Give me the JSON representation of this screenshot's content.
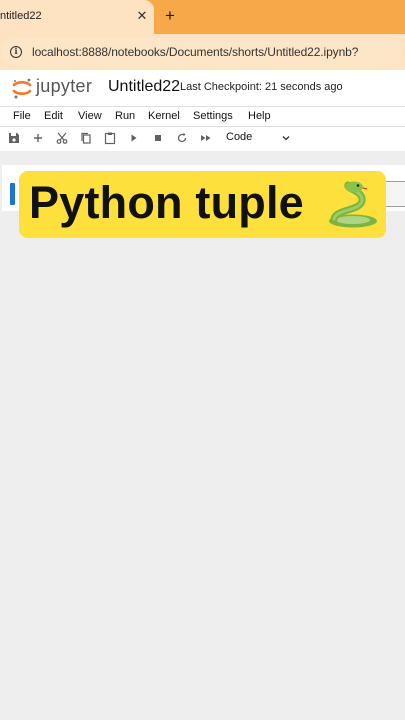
{
  "browser": {
    "tab_title": "ntitled22",
    "close_glyph": "✕",
    "new_tab_glyph": "+",
    "url": "localhost:8888/notebooks/Documents/shorts/Untitled22.ipynb?",
    "info_glyph": "i"
  },
  "jupyter": {
    "brand": "jupyter",
    "notebook_title": "Untitled22",
    "checkpoint": "Last Checkpoint: 21 seconds ago",
    "menu": [
      "File",
      "Edit",
      "View",
      "Run",
      "Kernel",
      "Settings",
      "Help"
    ],
    "toolbar_icons": [
      "save-icon",
      "add-cell-icon",
      "cut-icon",
      "copy-icon",
      "paste-icon",
      "run-icon",
      "stop-icon",
      "restart-icon",
      "fast-forward-icon"
    ],
    "cell_type": "Code"
  },
  "overlay": {
    "title": "Python tuple",
    "emoji_icon": "snake-icon",
    "background": "#fde03b"
  },
  "colors": {
    "tabbar": "#f7a94a",
    "address_bar": "#fde3c2",
    "active_cell": "#1976d2",
    "jupyter_orange": "#f37726"
  }
}
